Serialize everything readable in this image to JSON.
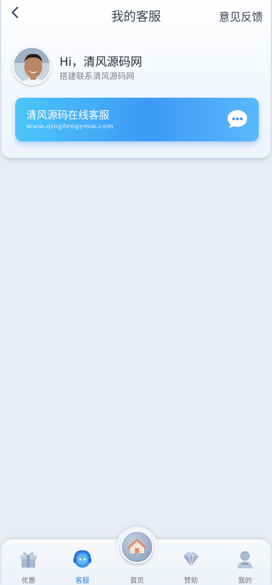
{
  "header": {
    "title": "我的客服",
    "feedback_label": "意见反馈",
    "back_icon": "chevron-left-icon"
  },
  "user": {
    "greeting": "Hi，清风源码网",
    "subtitle": "搭建联系清风源码网"
  },
  "service_card": {
    "title": "清风源码在线客服",
    "url_text": "www.qingfengymw.com",
    "icon": "chat-bubble-icon"
  },
  "tabs": [
    {
      "label": "优惠",
      "icon": "gift-icon",
      "active": false
    },
    {
      "label": "客服",
      "icon": "customer-service-icon",
      "active": true
    },
    {
      "label": "首页",
      "icon": "home-icon",
      "active": false
    },
    {
      "label": "赞助",
      "icon": "diamond-icon",
      "active": false
    },
    {
      "label": "我的",
      "icon": "user-icon",
      "active": false
    }
  ],
  "colors": {
    "accent": "#3d9af6",
    "active_tab": "#2f86e8",
    "background": "#e8edf3"
  }
}
